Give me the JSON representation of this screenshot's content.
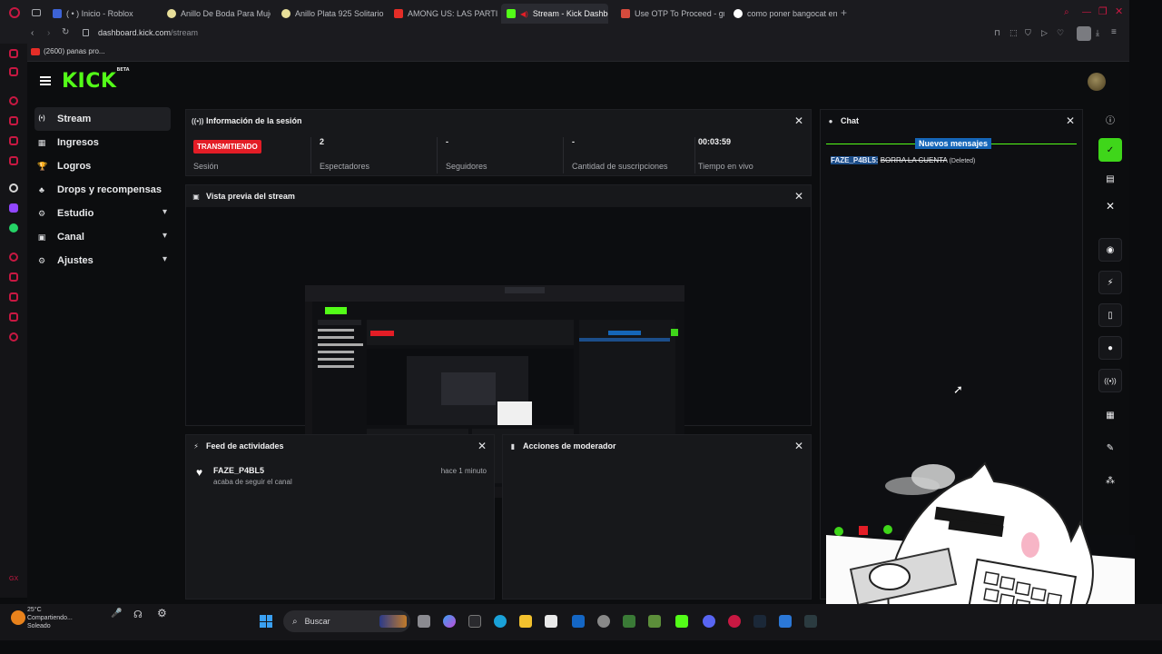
{
  "browser": {
    "tabs": [
      {
        "label": "( • ) Inicio - Roblox",
        "color": "#3d63d6"
      },
      {
        "label": "Anillo De Boda Para Muje",
        "color": "#e8df9a"
      },
      {
        "label": "Anillo Plata 925 Solitario",
        "color": "#e8df9a"
      },
      {
        "label": "AMONG US: LAS PARTID",
        "color": "#e52d27"
      },
      {
        "label": "Stream - Kick Dashbo",
        "color": "#53fc18"
      },
      {
        "label": "Use OTP To Proceed - gm",
        "color": "#d54b3d"
      },
      {
        "label": "como poner bangocat en",
        "color": "#ffffff"
      }
    ],
    "url_host": "dashboard.kick.com",
    "url_path": "/stream",
    "bookmark": "(2600) panas pro..."
  },
  "app": {
    "logo": "KICK",
    "logo_badge": "BETA",
    "nav": [
      {
        "label": "Stream",
        "icon": "stream-icon",
        "glyph": "(•)",
        "active": true,
        "has_chevron": false
      },
      {
        "label": "Ingresos",
        "icon": "revenue-icon",
        "glyph": "▦",
        "active": false,
        "has_chevron": false
      },
      {
        "label": "Logros",
        "icon": "trophy-icon",
        "glyph": "🏆",
        "active": false,
        "has_chevron": false
      },
      {
        "label": "Drops y recompensas",
        "icon": "drops-icon",
        "glyph": "♣",
        "active": false,
        "has_chevron": false
      },
      {
        "label": "Estudio",
        "icon": "studio-icon",
        "glyph": "⚙",
        "active": false,
        "has_chevron": true
      },
      {
        "label": "Canal",
        "icon": "channel-icon",
        "glyph": "▣",
        "active": false,
        "has_chevron": true
      },
      {
        "label": "Ajustes",
        "icon": "settings-icon",
        "glyph": "⚙",
        "active": false,
        "has_chevron": true
      }
    ]
  },
  "session": {
    "title": "Información de la sesión",
    "status": "TRANSMITIENDO",
    "status_label": "Sesión",
    "viewers": "2",
    "viewers_label": "Espectadores",
    "followers": "-",
    "followers_label": "Seguidores",
    "subs": "-",
    "subs_label": "Cantidad de suscripciones",
    "live_time": "00:03:59",
    "live_time_label": "Tiempo en vivo"
  },
  "preview": {
    "title": "Vista previa del stream"
  },
  "feed": {
    "title": "Feed de actividades",
    "items": [
      {
        "user": "FAZE_P4BL5",
        "action": "acaba de seguir el canal",
        "time": "hace 1 minuto"
      }
    ]
  },
  "mod": {
    "title": "Acciones de moderador"
  },
  "chat": {
    "title": "Chat",
    "new_messages": "Nuevos mensajes",
    "message": {
      "user": "FAZE_P4BL5:",
      "text": "BORRA LA CUENTA",
      "note": "(Deleted)"
    }
  },
  "taskbar": {
    "search_placeholder": "Buscar",
    "weather_temp": "25°C",
    "weather_status": "Compartiendo...",
    "weather_desc": "Soleado"
  },
  "colors": {
    "accent": "#53fc18",
    "live": "#e31d26",
    "highlight": "#1566b8"
  }
}
